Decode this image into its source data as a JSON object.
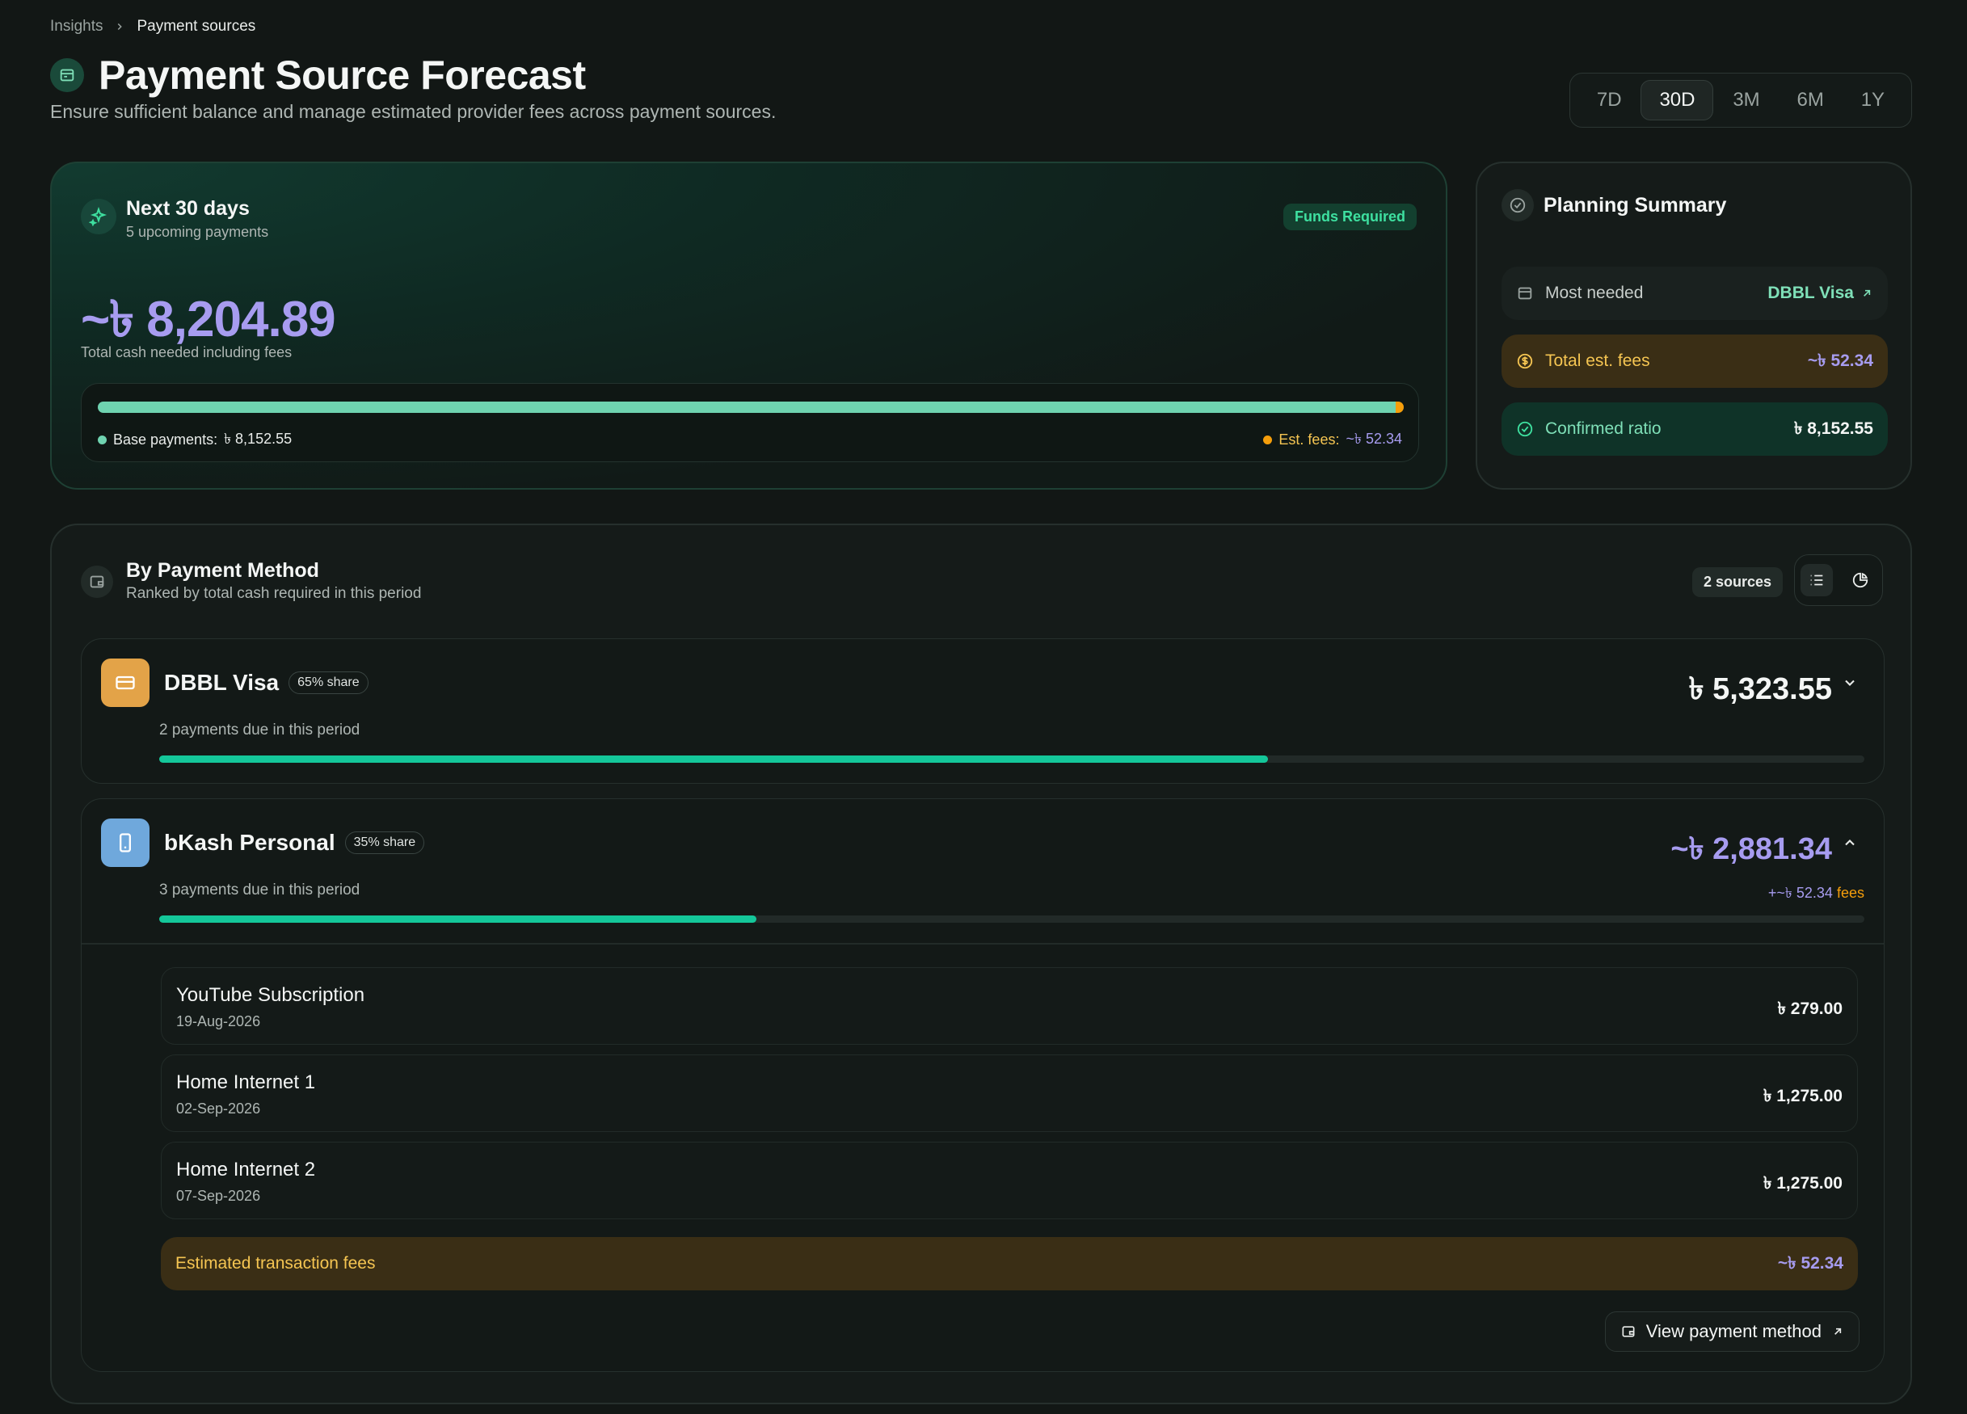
{
  "breadcrumb": {
    "parent": "Insights",
    "current": "Payment sources"
  },
  "header": {
    "title": "Payment Source Forecast",
    "subtitle": "Ensure sufficient balance and manage estimated provider fees across payment sources.",
    "ranges": [
      "7D",
      "30D",
      "3M",
      "6M",
      "1Y"
    ],
    "selected_range": "30D"
  },
  "next": {
    "title": "Next 30 days",
    "subtitle": "5 upcoming payments",
    "badge": "Funds Required",
    "total": "~৳ 8,204.89",
    "total_label": "Total cash needed including fees",
    "base_label": "Base payments:",
    "base_value": "৳ 8,152.55",
    "fees_label": "Est. fees:",
    "fees_value": "~৳ 52.34",
    "base_fraction": 0.9936
  },
  "planning": {
    "title": "Planning Summary",
    "rows": [
      {
        "label": "Most needed",
        "value": "DBBL Visa"
      },
      {
        "label": "Total est. fees",
        "value": "~৳ 52.34"
      },
      {
        "label": "Confirmed ratio",
        "value": "৳ 8,152.55"
      }
    ]
  },
  "methods": {
    "title": "By Payment Method",
    "subtitle": "Ranked by total cash required in this period",
    "count_badge": "2 sources",
    "items": [
      {
        "name": "DBBL Visa",
        "share": "65% share",
        "due": "2 payments due in this period",
        "amount": "৳ 5,323.55",
        "fill": 0.65,
        "icon_color": "#e3a348"
      },
      {
        "name": "bKash Personal",
        "share": "35% share",
        "due": "3 payments due in this period",
        "amount": "~৳ 2,881.34",
        "fee_prefix": "+~৳ 52.34",
        "fee_suffix": "fees",
        "fill": 0.35,
        "icon_color": "#6fa8dc",
        "payments": [
          {
            "name": "YouTube Subscription",
            "date": "19-Aug-2026",
            "amount": "৳ 279.00"
          },
          {
            "name": "Home Internet 1",
            "date": "02-Sep-2026",
            "amount": "৳ 1,275.00"
          },
          {
            "name": "Home Internet 2",
            "date": "07-Sep-2026",
            "amount": "৳ 1,275.00"
          }
        ],
        "fee_row_label": "Estimated transaction fees",
        "fee_row_value": "~৳ 52.34",
        "view_label": "View payment method"
      }
    ]
  },
  "colors": {
    "accent": "#14c79a",
    "purple": "#a79cf0",
    "amber": "#f59e0b",
    "bg": "#121715"
  }
}
